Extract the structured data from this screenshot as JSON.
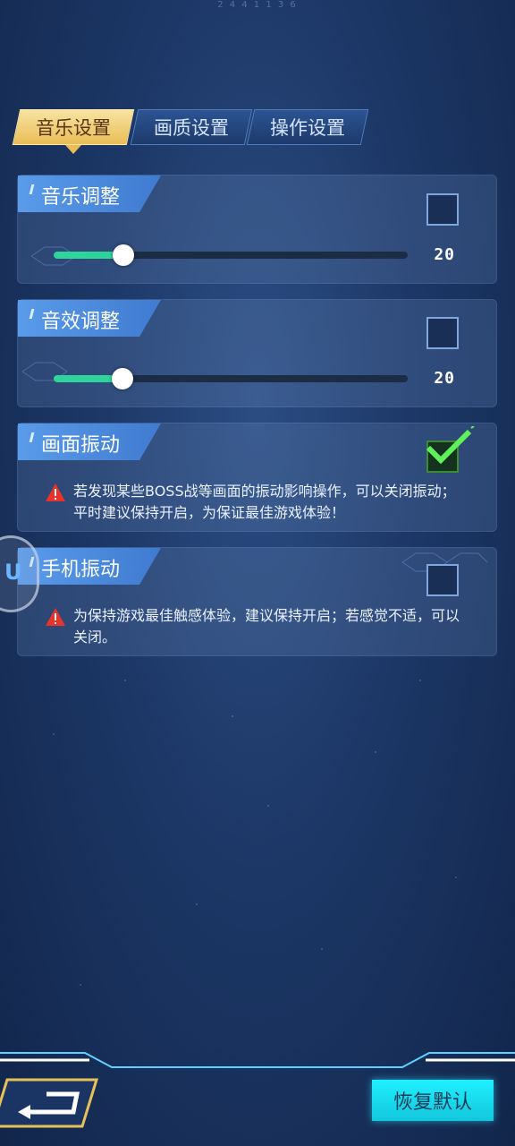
{
  "header": {
    "top_text": "2 4 4 1 1 3 6"
  },
  "tabs": [
    {
      "label": "音乐设置",
      "active": true
    },
    {
      "label": "画质设置",
      "active": false
    },
    {
      "label": "操作设置",
      "active": false
    }
  ],
  "music": {
    "title": "音乐调整",
    "value": "20",
    "level": 0.2,
    "mute_checked": false
  },
  "sfx": {
    "title": "音效调整",
    "value": "20",
    "level": 0.2,
    "mute_checked": false
  },
  "screen_shake": {
    "title": "画面振动",
    "checked": true,
    "warning": "若发现某些BOSS战等画面的振动影响操作，可以关闭振动；平时建议保持开启，为保证最佳游戏体验！"
  },
  "phone_vibration": {
    "title": "手机振动",
    "checked": false,
    "warning": "为保持游戏最佳触感体验，建议保持开启；若感觉不适，可以关闭。"
  },
  "floating_badge": {
    "text": "U"
  },
  "bottom": {
    "reset_label": "恢复默认"
  },
  "colors": {
    "accent": "#2fd49b",
    "tab_active": "#e9bc55",
    "reset": "#1ff0ff",
    "check": "#5ff05a"
  }
}
